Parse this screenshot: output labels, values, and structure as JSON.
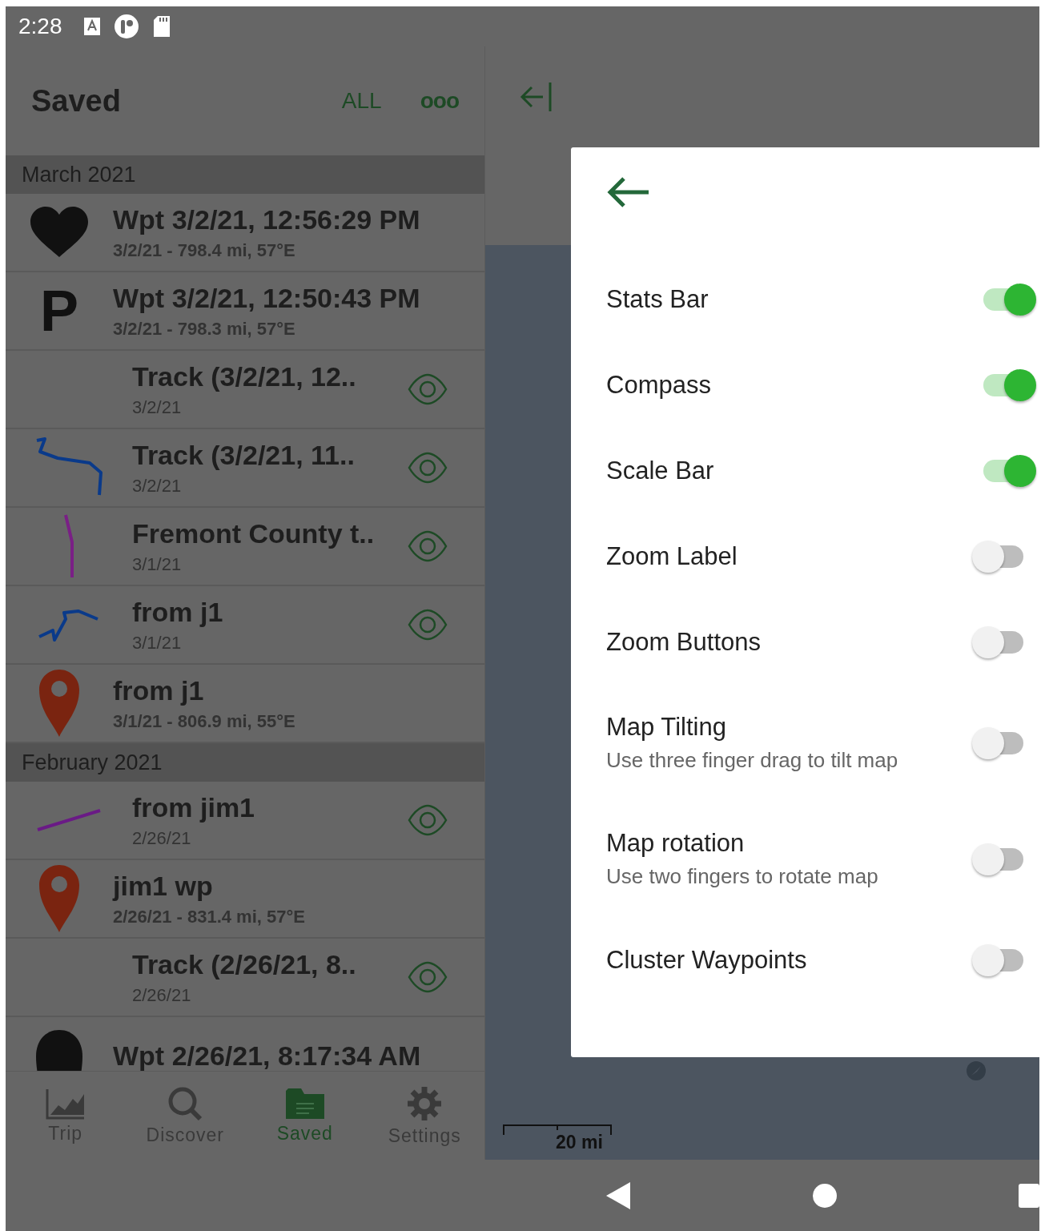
{
  "status_bar": {
    "time": "2:28"
  },
  "saved_panel": {
    "title": "Saved",
    "filter": "ALL",
    "more": "ooo",
    "sections": [
      {
        "heading": "March 2021",
        "rows": [
          {
            "kind": "waypoint",
            "icon": {
              "kind": "heart"
            },
            "title": "Wpt 3/2/21, 12:56:29 PM",
            "subtitle": "3/2/21 - 798.4 mi, 57°E"
          },
          {
            "kind": "waypoint",
            "icon": {
              "kind": "letter",
              "text": "P"
            },
            "title": "Wpt 3/2/21, 12:50:43 PM",
            "subtitle": "3/2/21 - 798.3 mi, 57°E"
          },
          {
            "kind": "track",
            "icon": {
              "kind": "none"
            },
            "title": "Track (3/2/21, 12..",
            "subtitle": "3/2/21"
          },
          {
            "kind": "track",
            "icon": {
              "kind": "track",
              "color": "#0a3a8a"
            },
            "title": "Track (3/2/21, 11..",
            "subtitle": "3/2/21"
          },
          {
            "kind": "track",
            "icon": {
              "kind": "track",
              "color": "#7a1f86"
            },
            "title": "Fremont County t..",
            "subtitle": "3/1/21"
          },
          {
            "kind": "track",
            "icon": {
              "kind": "track",
              "color": "#0a3a8a"
            },
            "title": "from j1",
            "subtitle": "3/1/21"
          },
          {
            "kind": "waypoint",
            "icon": {
              "kind": "pin",
              "color": "#7a2410"
            },
            "title": "from j1",
            "subtitle": "3/1/21 - 806.9 mi, 55°E"
          }
        ]
      },
      {
        "heading": "February 2021",
        "rows": [
          {
            "kind": "track",
            "icon": {
              "kind": "track",
              "color": "#6a1a86"
            },
            "title": "from jim1",
            "subtitle": "2/26/21"
          },
          {
            "kind": "waypoint",
            "icon": {
              "kind": "pin",
              "color": "#7a2410"
            },
            "title": "jim1 wp",
            "subtitle": "2/26/21 - 831.4 mi, 57°E"
          },
          {
            "kind": "track",
            "icon": {
              "kind": "none"
            },
            "title": "Track (2/26/21, 8..",
            "subtitle": "2/26/21"
          },
          {
            "kind": "waypoint",
            "icon": {
              "kind": "blob"
            },
            "title": "Wpt 2/26/21, 8:17:34 AM"
          }
        ]
      }
    ]
  },
  "bottom_tabs": [
    {
      "label": "Trip",
      "selected": false
    },
    {
      "label": "Discover",
      "selected": false
    },
    {
      "label": "Saved",
      "selected": true
    },
    {
      "label": "Settings",
      "selected": false
    }
  ],
  "map": {
    "scale_label": "20 mi"
  },
  "settings_sheet": {
    "items": [
      {
        "label": "Stats Bar",
        "on": true
      },
      {
        "label": "Compass",
        "on": true
      },
      {
        "label": "Scale Bar",
        "on": true
      },
      {
        "label": "Zoom Label",
        "on": false
      },
      {
        "label": "Zoom Buttons",
        "on": false
      },
      {
        "label": "Map Tilting",
        "description": "Use three finger drag to tilt map",
        "on": false
      },
      {
        "label": "Map rotation",
        "description": "Use two fingers to rotate map",
        "on": false
      },
      {
        "label": "Cluster Waypoints",
        "on": false
      }
    ]
  }
}
